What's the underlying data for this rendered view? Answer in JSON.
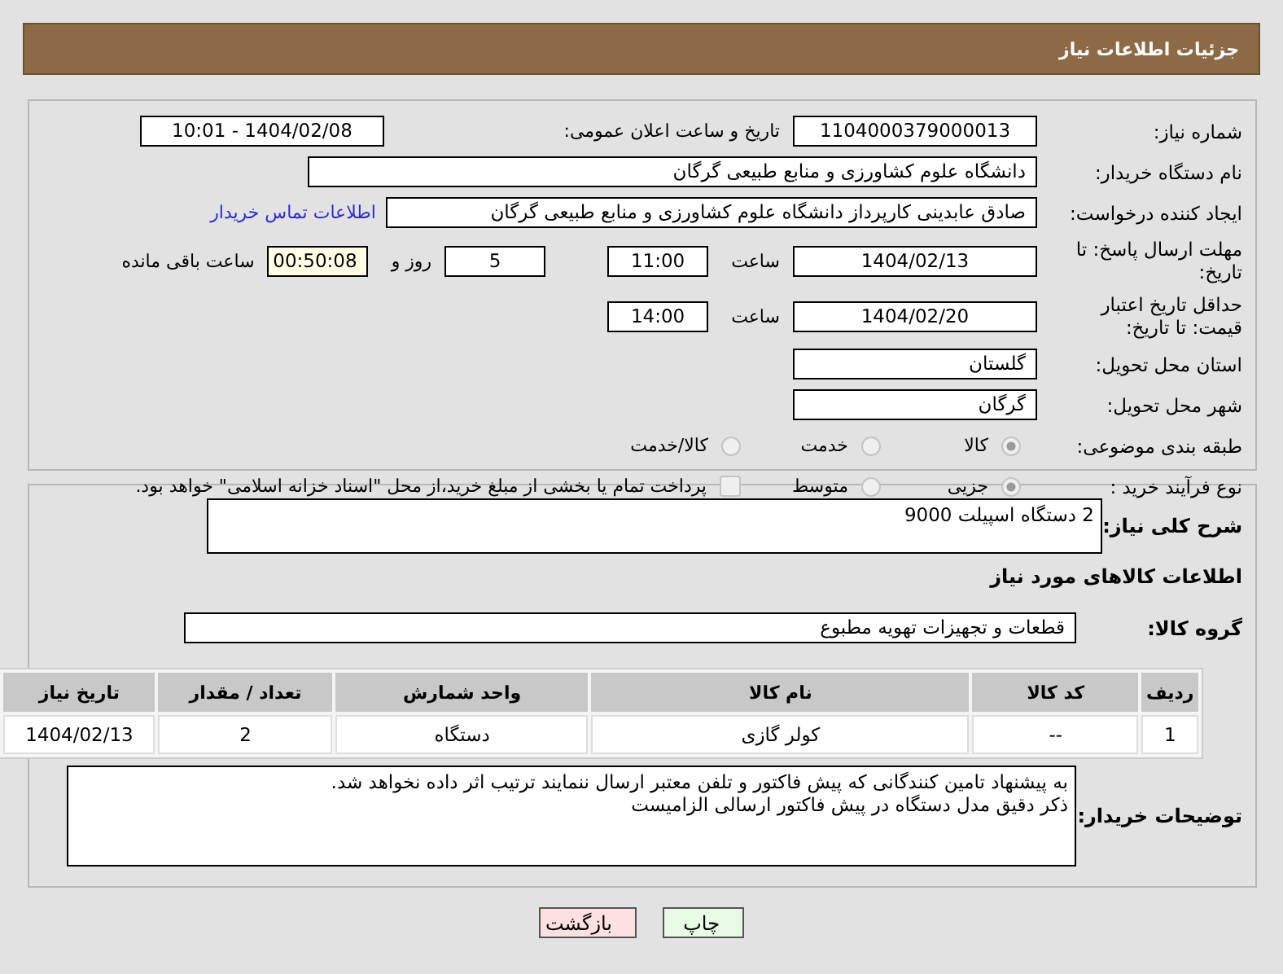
{
  "header": {
    "title": "جزئیات اطلاعات نیاز"
  },
  "need_number": {
    "label": "شماره نیاز:",
    "value": "1104000379000013"
  },
  "announce": {
    "label": "تاریخ و ساعت اعلان عمومی:",
    "value": "1404/02/08 - 10:01"
  },
  "buyer_org": {
    "label": "نام دستگاه خریدار:",
    "value": "دانشگاه علوم کشاورزی و منابع طبیعی گرگان"
  },
  "creator": {
    "label": "ایجاد کننده درخواست:",
    "value": "صادق عابدینی کارپرداز دانشگاه علوم کشاورزی و منابع طبیعی گرگان",
    "link": "اطلاعات تماس خریدار"
  },
  "deadline": {
    "label": "مهلت ارسال پاسخ: تا تاریخ:",
    "date": "1404/02/13",
    "time_label": "ساعت",
    "time": "11:00",
    "days": "5",
    "days_label": "روز و",
    "remaining": "00:50:08",
    "remaining_label": "ساعت باقی مانده"
  },
  "validity": {
    "label": "حداقل تاریخ اعتبار قیمت: تا تاریخ:",
    "date": "1404/02/20",
    "time_label": "ساعت",
    "time": "14:00"
  },
  "province": {
    "label": "استان محل تحویل:",
    "value": "گلستان"
  },
  "city": {
    "label": "شهر محل تحویل:",
    "value": "گرگان"
  },
  "category": {
    "label": "طبقه بندی موضوعی:",
    "options": [
      {
        "label": "کالا",
        "selected": true
      },
      {
        "label": "خدمت",
        "selected": false
      },
      {
        "label": "کالا/خدمت",
        "selected": false
      }
    ]
  },
  "process": {
    "label": "نوع فرآیند خرید :",
    "options": [
      {
        "label": "جزیی",
        "selected": true
      },
      {
        "label": "متوسط",
        "selected": false
      }
    ],
    "payment": {
      "label": "پرداخت تمام یا بخشی از مبلغ خرید،از محل \"اسناد خزانه اسلامی\" خواهد بود.",
      "checked": false
    }
  },
  "description": {
    "label": "شرح کلی نیاز:",
    "value": "2 دستگاه اسپیلت 9000"
  },
  "goods_title": "اطلاعات کالاهای مورد نیاز",
  "goods_group": {
    "label": "گروه کالا:",
    "value": "قطعات و تجهیزات تهویه مطبوع"
  },
  "table": {
    "columns": [
      "ردیف",
      "کد کالا",
      "نام کالا",
      "واحد شمارش",
      "تعداد / مقدار",
      "تاریخ نیاز"
    ],
    "rows": [
      [
        "1",
        "--",
        "کولر گازی",
        "دستگاه",
        "2",
        "1404/02/13"
      ]
    ]
  },
  "buyer_notes": {
    "label": "توضیحات خریدار:",
    "lines": [
      "به پیشنهاد تامین کنندگانی که پیش فاکتور و تلفن معتبر ارسال ننمایند ترتیب اثر داده نخواهد شد.",
      "ذکر دقیق مدل دستگاه در پیش فاکتور ارسالی الزامیست"
    ]
  },
  "buttons": [
    {
      "label": "چاپ",
      "kind": "print"
    },
    {
      "label": "بازگشت",
      "kind": "back"
    }
  ]
}
